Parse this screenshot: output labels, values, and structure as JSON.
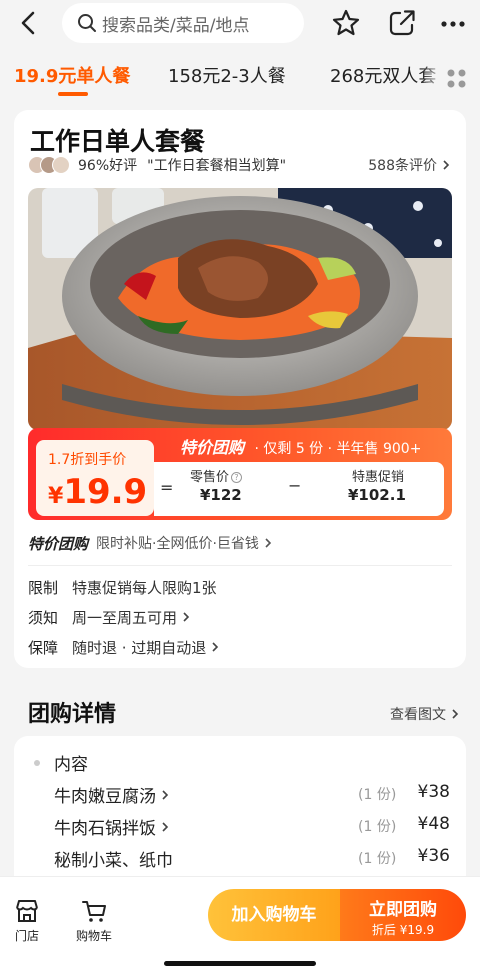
{
  "search": {
    "placeholder": "搜索品类/菜品/地点"
  },
  "icons": {
    "back": "chevron-left-icon",
    "search": "search-icon",
    "favorite": "star-icon",
    "share": "share-icon",
    "more": "more-dots-icon",
    "grid": "grid-icon",
    "store": "store-icon",
    "cart": "cart-icon"
  },
  "tabs": [
    {
      "label": "19.9元单人餐",
      "active": true
    },
    {
      "label": "158元2-3人餐",
      "active": false
    },
    {
      "label": "268元双人套",
      "active": false
    }
  ],
  "deal": {
    "title": "工作日单人套餐",
    "good_rate": "96%好评",
    "quote": "\"工作日套餐相当划算\"",
    "review_count": "588条评价"
  },
  "price_banner": {
    "brand": "特价团购",
    "remaining": "· 仅剩 5 份 ·",
    "half_year_sales": "半年售 900+",
    "discount_label": "1.7折到手价",
    "currency": "¥",
    "price": "19.9",
    "equals": "=",
    "retail_label": "零售价",
    "retail_value": "¥122",
    "minus": "−",
    "promo_label": "特惠促销",
    "promo_value": "¥102.1"
  },
  "tejia": {
    "brand": "特价团购",
    "text": "限时补贴·全网低价·巨省钱"
  },
  "info": [
    {
      "label": "限制",
      "value": "特惠促销每人限购1张",
      "link": false
    },
    {
      "label": "须知",
      "value": "周一至周五可用",
      "link": true
    },
    {
      "label": "保障",
      "value": "随时退 · 过期自动退",
      "link": true
    }
  ],
  "details": {
    "title": "团购详情",
    "view_pics": "查看图文",
    "content_label": "内容",
    "items": [
      {
        "name": "牛肉嫩豆腐汤",
        "link": true,
        "qty": "(1 份)",
        "price": "¥38"
      },
      {
        "name": "牛肉石锅拌饭",
        "link": true,
        "qty": "(1 份)",
        "price": "¥48"
      },
      {
        "name": "秘制小菜、纸巾",
        "link": false,
        "qty": "(1 份)",
        "price": "¥36"
      }
    ]
  },
  "bottom": {
    "store_label": "门店",
    "cart_label": "购物车",
    "add_cart": "加入购物车",
    "buy_now": "立即团购",
    "buy_now_sub": "折后 ¥19.9"
  },
  "colors": {
    "accent": "#ff5a00",
    "price_red": "#ff3300",
    "cart_yellow": "#ffa21a",
    "buy_orange": "#ff4a0a"
  }
}
